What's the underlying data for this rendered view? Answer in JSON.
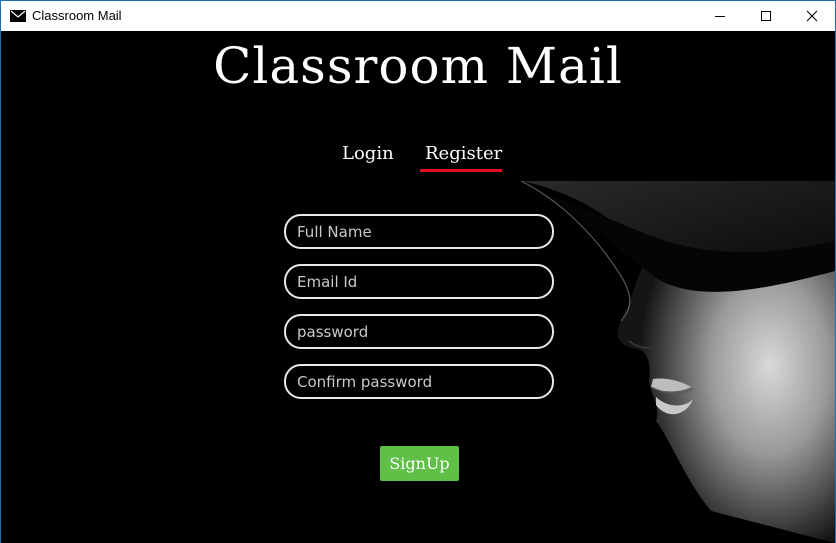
{
  "window": {
    "title": "Classroom Mail",
    "icon": "envelope-icon",
    "controls": [
      "minimize-icon",
      "maximize-icon",
      "close-icon"
    ]
  },
  "app": {
    "title": "Classroom Mail"
  },
  "tabs": [
    {
      "label": "Login",
      "active": false
    },
    {
      "label": "Register",
      "active": true
    }
  ],
  "form": {
    "full_name_placeholder": "Full Name",
    "email_placeholder": "Email Id",
    "password_placeholder": "password",
    "confirm_password_placeholder": "Confirm password",
    "submit_label": "SignUp"
  },
  "colors": {
    "background": "#000000",
    "active_tab_underline": "#e0101c",
    "signup_button": "#5fbf46",
    "field_border": "#e8e8e8"
  }
}
